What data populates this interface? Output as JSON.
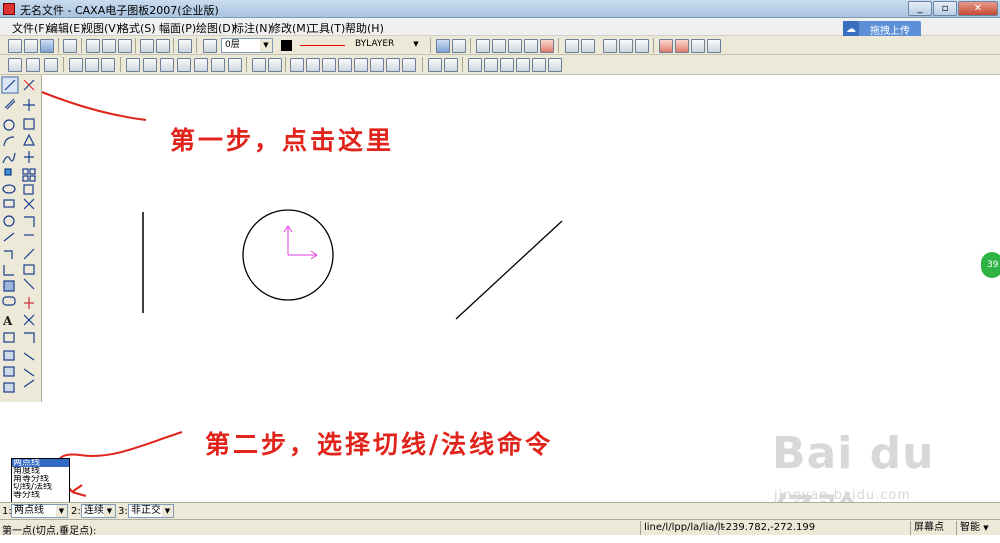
{
  "window": {
    "title": "无名文件 - CAXA电子图板2007(企业版)",
    "buttons": {
      "minimize": "_",
      "restore": "▫",
      "close": "✕"
    }
  },
  "menu": {
    "items": [
      "文件(F)",
      "编辑(E)",
      "视图(V)",
      "格式(S)",
      "幅面(P)",
      "绘图(D)",
      "标注(N)",
      "修改(M)",
      "工具(T)",
      "帮助(H)"
    ]
  },
  "upload_button": {
    "label": "拖拽上传"
  },
  "toolbar": {
    "layer_value": "0层",
    "linetype_value": "BYLAYER"
  },
  "annotations": {
    "step1": "第一步，点击这里",
    "step2": "第二步，选择切线/法线命令"
  },
  "dropdown": {
    "options": [
      "两点线",
      "角度线",
      "角等分线",
      "切线/法线",
      "等分线"
    ],
    "selected_index": 0
  },
  "command_bar": {
    "field1_label": "1:",
    "field1_value": "两点线",
    "field2_label": "2:",
    "field2_value": "连续",
    "field3_label": "3:",
    "field3_value": "非正交"
  },
  "status": {
    "prompt": "第一点(切点,垂足点):",
    "command": "line/l/lpp/la/lia/lt",
    "coords": "-239.782,-272.199",
    "snap_mode": "屏幕点",
    "smart": "智能"
  },
  "watermark": {
    "brand": "Bai du 经验",
    "url": "jingyan.baidu.com"
  },
  "side_bubble": {
    "text": "39"
  },
  "colors": {
    "annotation_red": "#e0241b",
    "selection_blue": "#316ac5",
    "ucs_magenta": "#e040e0"
  }
}
